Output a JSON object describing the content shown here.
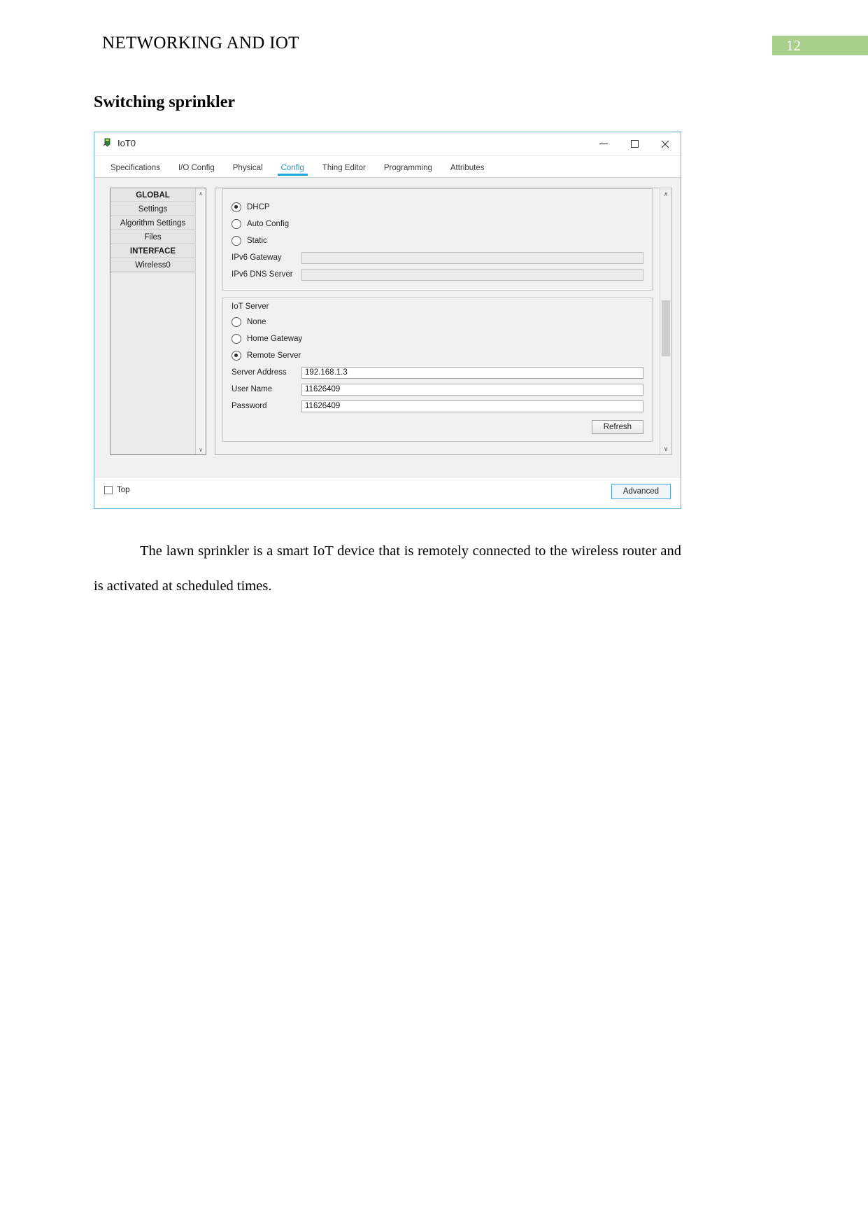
{
  "document": {
    "header_title": "NETWORKING AND IOT",
    "page_number": "12",
    "page_badge_color": "#a9cf8d",
    "section_heading": "Switching sprinkler",
    "caption": "The lawn sprinkler is a smart IoT device that is remotely connected to the wireless router and is activated at scheduled times."
  },
  "window": {
    "title": "IoT0",
    "icon": "device-icon",
    "controls": {
      "minimize": "–",
      "maximize": "□",
      "close": "✕"
    }
  },
  "tabs": [
    {
      "label": "Specifications",
      "active": false
    },
    {
      "label": "I/O Config",
      "active": false
    },
    {
      "label": "Physical",
      "active": false
    },
    {
      "label": "Config",
      "active": true
    },
    {
      "label": "Thing Editor",
      "active": false
    },
    {
      "label": "Programming",
      "active": false
    },
    {
      "label": "Attributes",
      "active": false
    }
  ],
  "tab_accent_color": "#17a5dd",
  "sidebar": {
    "items": [
      {
        "label": "GLOBAL",
        "is_header": true
      },
      {
        "label": "Settings",
        "is_header": false
      },
      {
        "label": "Algorithm Settings",
        "is_header": false
      },
      {
        "label": "Files",
        "is_header": false
      },
      {
        "label": "INTERFACE",
        "is_header": true
      },
      {
        "label": "Wireless0",
        "is_header": false
      }
    ],
    "scroll_up": "∧",
    "scroll_down": "∨"
  },
  "ip_config": {
    "options": [
      {
        "label": "DHCP",
        "selected": true
      },
      {
        "label": "Auto Config",
        "selected": false
      },
      {
        "label": "Static",
        "selected": false
      }
    ],
    "fields": [
      {
        "label": "IPv6 Gateway",
        "value": "",
        "disabled": true
      },
      {
        "label": "IPv6 DNS Server",
        "value": "",
        "disabled": true
      }
    ]
  },
  "iot_server": {
    "title": "IoT Server",
    "options": [
      {
        "label": "None",
        "selected": false
      },
      {
        "label": "Home Gateway",
        "selected": false
      },
      {
        "label": "Remote Server",
        "selected": true
      }
    ],
    "fields": [
      {
        "label": "Server Address",
        "value": "192.168.1.3",
        "disabled": false
      },
      {
        "label": "User Name",
        "value": "11626409",
        "disabled": false
      },
      {
        "label": "Password",
        "value": "11626409",
        "disabled": false
      }
    ],
    "refresh_label": "Refresh"
  },
  "config_scroll": {
    "up": "∧",
    "down": "∨"
  },
  "bottombar": {
    "top_checkbox_label": "Top",
    "top_checkbox_checked": false,
    "advanced_label": "Advanced"
  }
}
